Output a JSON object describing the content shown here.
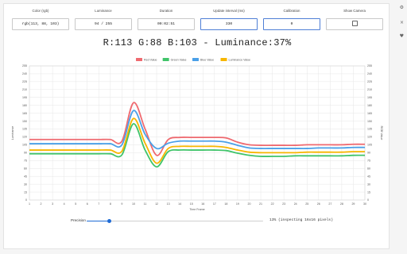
{
  "fields": {
    "color": {
      "label": "Color (rgb)",
      "value": "rgb(113, 88, 103)"
    },
    "luminance": {
      "label": "Luminance",
      "value": "94 / 255"
    },
    "duration": {
      "label": "Duration",
      "value": "00:02:51"
    },
    "interval": {
      "label": "Update interval (ms)",
      "value": "330"
    },
    "calibration": {
      "label": "Calibration",
      "value": "0"
    },
    "camera": {
      "label": "Show Camera",
      "checked": false
    }
  },
  "status": "R:113 G:88 B:103 - Luminance:37%",
  "side_icons": {
    "gear": "⚙",
    "close": "×",
    "heart": "♥"
  },
  "precision": {
    "label": "Precision",
    "value": 0.13,
    "text": "13% (inspecting 16x16 pixels)"
  },
  "chart_data": {
    "type": "line",
    "title": "",
    "xlabel": "Time Frame",
    "ylabel": "Luminance",
    "y2label": "RGB Value",
    "xlim": [
      1,
      30
    ],
    "ylim": [
      0,
      255
    ],
    "yticks": [
      0,
      15,
      30,
      45,
      60,
      75,
      90,
      105,
      120,
      135,
      150,
      165,
      180,
      195,
      210,
      225,
      240,
      255
    ],
    "grid": true,
    "legend_position": "top",
    "x": [
      1,
      2,
      3,
      4,
      5,
      6,
      7,
      8,
      9,
      10,
      11,
      12,
      13,
      14,
      15,
      16,
      17,
      18,
      19,
      20,
      21,
      22,
      23,
      24,
      25,
      26,
      27,
      28,
      29,
      30
    ],
    "series": [
      {
        "name": "Red Value",
        "color": "#ef6a70",
        "values": [
          115,
          115,
          115,
          115,
          115,
          115,
          115,
          115,
          112,
          185,
          135,
          85,
          115,
          119,
          119,
          119,
          119,
          118,
          110,
          105,
          104,
          104,
          104,
          104,
          105,
          105,
          105,
          105,
          106,
          106
        ]
      },
      {
        "name": "Green Value",
        "color": "#40c46a",
        "values": [
          88,
          88,
          88,
          88,
          88,
          88,
          88,
          88,
          86,
          145,
          95,
          63,
          92,
          95,
          95,
          95,
          95,
          94,
          89,
          85,
          83,
          83,
          83,
          84,
          84,
          84,
          84,
          84,
          85,
          85
        ]
      },
      {
        "name": "Blue Value",
        "color": "#4aa0e8",
        "values": [
          107,
          107,
          107,
          107,
          107,
          107,
          107,
          107,
          105,
          170,
          125,
          98,
          108,
          112,
          112,
          112,
          112,
          110,
          104,
          99,
          98,
          98,
          98,
          98,
          98,
          99,
          99,
          99,
          100,
          100
        ]
      },
      {
        "name": "Luminance Value",
        "color": "#f7b600",
        "values": [
          95,
          95,
          95,
          95,
          95,
          95,
          95,
          95,
          93,
          155,
          108,
          70,
          98,
          102,
          102,
          102,
          102,
          100,
          95,
          91,
          90,
          90,
          90,
          90,
          91,
          91,
          91,
          91,
          92,
          92
        ]
      }
    ]
  }
}
